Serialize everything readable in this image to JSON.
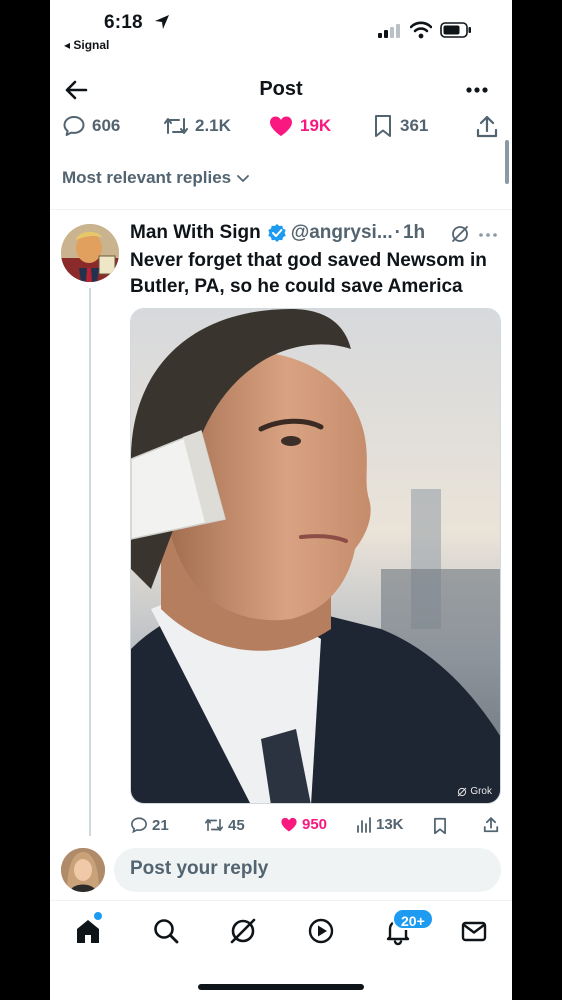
{
  "status_bar": {
    "time": "6:18",
    "back_app": "◂ Signal"
  },
  "header": {
    "title": "Post"
  },
  "post_stats": {
    "replies": "606",
    "reposts": "2.1K",
    "likes": "19K",
    "bookmarks": "361"
  },
  "sort_label": "Most relevant replies",
  "reply": {
    "name": "Man With Sign",
    "handle": "@angrysi...",
    "separator": "·",
    "time": "1h",
    "text": "Never forget that god saved Newsom in Butler, PA, so he could save America",
    "media_watermark": "Grok",
    "stats": {
      "replies": "21",
      "reposts": "45",
      "likes": "950",
      "views": "13K"
    }
  },
  "composer": {
    "placeholder": "Post your reply"
  },
  "tabbar": {
    "notifications_badge": "20+"
  },
  "colors": {
    "like_pink": "#f91880",
    "accent_blue": "#1d9bf0",
    "muted_gray": "#536471"
  }
}
